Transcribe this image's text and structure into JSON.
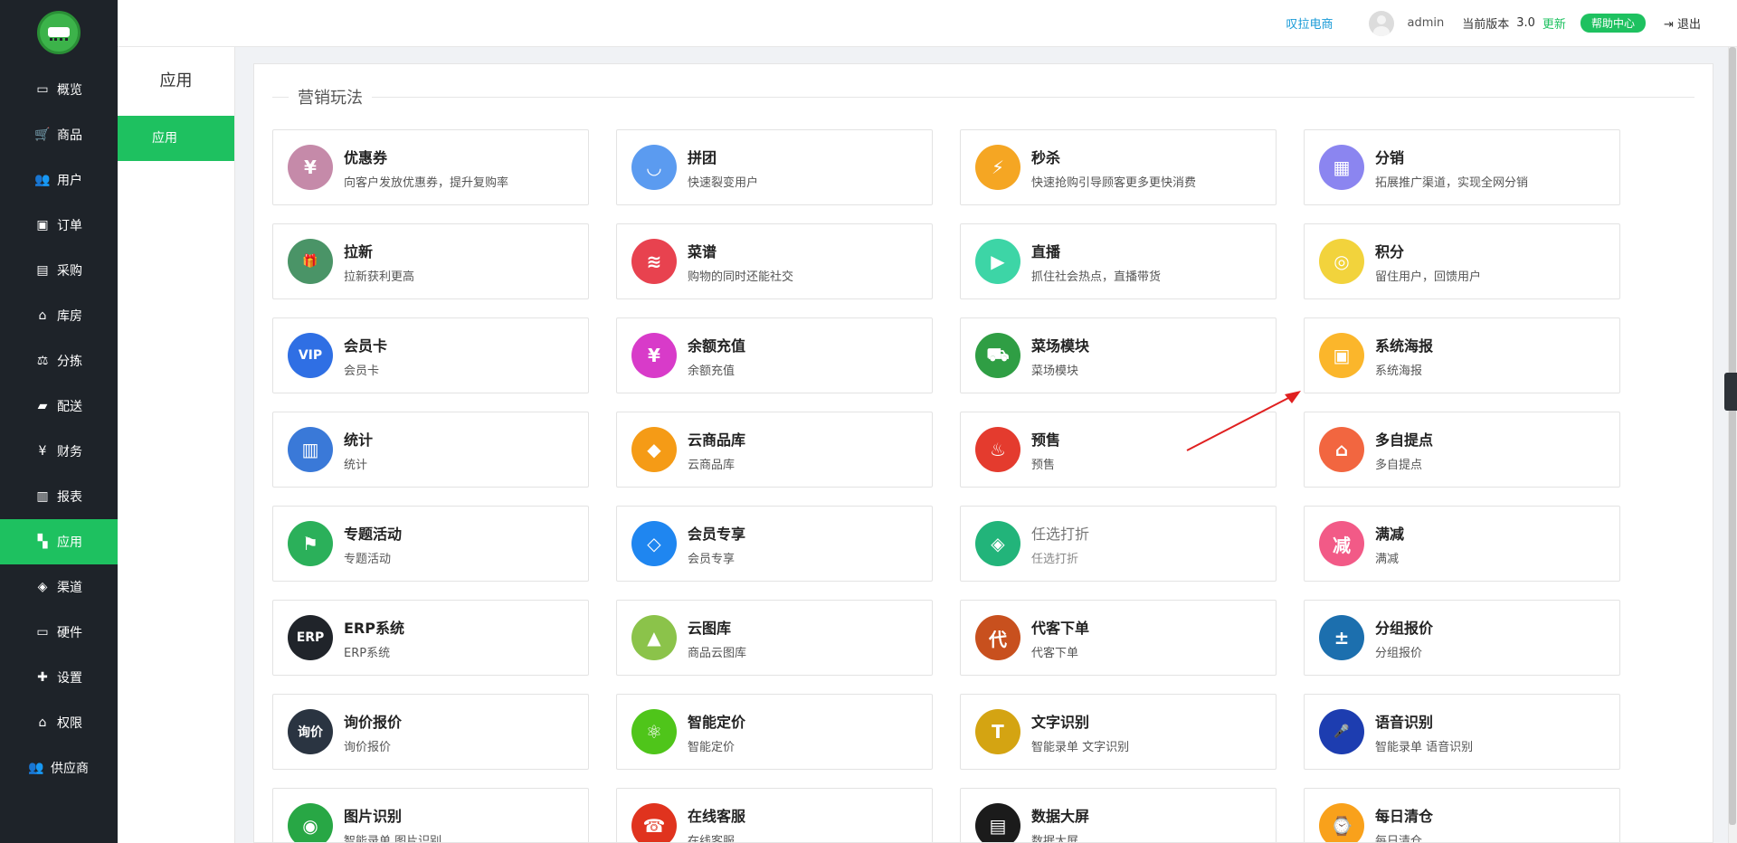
{
  "nav": {
    "items": [
      {
        "label": "概览",
        "icon": "monitor-icon",
        "glyph": "▭"
      },
      {
        "label": "商品",
        "icon": "cart-icon",
        "glyph": "🛒"
      },
      {
        "label": "用户",
        "icon": "users-icon",
        "glyph": "👥"
      },
      {
        "label": "订单",
        "icon": "money-icon",
        "glyph": "▣"
      },
      {
        "label": "采购",
        "icon": "truck-icon",
        "glyph": "▤"
      },
      {
        "label": "库房",
        "icon": "home-icon",
        "glyph": "⌂"
      },
      {
        "label": "分拣",
        "icon": "scale-icon",
        "glyph": "⚖"
      },
      {
        "label": "配送",
        "icon": "delivery-icon",
        "glyph": "▰"
      },
      {
        "label": "财务",
        "icon": "yen-icon",
        "glyph": "¥"
      },
      {
        "label": "报表",
        "icon": "bar-chart-icon",
        "glyph": "▥"
      },
      {
        "label": "应用",
        "icon": "apps-icon",
        "glyph": "▚",
        "active": true
      },
      {
        "label": "渠道",
        "icon": "cube-icon",
        "glyph": "◈"
      },
      {
        "label": "硬件",
        "icon": "desktop-icon",
        "glyph": "▭"
      },
      {
        "label": "设置",
        "icon": "puzzle-icon",
        "glyph": "✚"
      },
      {
        "label": "权限",
        "icon": "bank-icon",
        "glyph": "⌂"
      },
      {
        "label": "供应商",
        "icon": "supplier-icon",
        "glyph": "👥"
      }
    ]
  },
  "subnav": {
    "title": "应用",
    "item": "应用"
  },
  "header": {
    "brand": "叹拉电商",
    "user": "admin",
    "version_label": "当前版本",
    "version": "3.0",
    "update": "更新",
    "help": "帮助中心",
    "logout": "退出"
  },
  "section": {
    "title": "营销玩法"
  },
  "apps": [
    {
      "name": "优惠券",
      "desc": "向客户发放优惠券，提升复购率",
      "color": "#c58aa9",
      "glyph": "¥"
    },
    {
      "name": "拼团",
      "desc": "快速裂变用户",
      "color": "#5b9bf0",
      "glyph": "◡"
    },
    {
      "name": "秒杀",
      "desc": "快速抢购引导顾客更多更快消费",
      "color": "#f5a623",
      "glyph": "⚡"
    },
    {
      "name": "分销",
      "desc": "拓展推广渠道，实现全网分销",
      "color": "#8b85f0",
      "glyph": "▦"
    },
    {
      "name": "拉新",
      "desc": "拉新获利更高",
      "color": "#4a9467",
      "glyph": "🎁"
    },
    {
      "name": "菜谱",
      "desc": "购物的同时还能社交",
      "color": "#e8424f",
      "glyph": "≋"
    },
    {
      "name": "直播",
      "desc": "抓住社会热点，直播带货",
      "color": "#3dd5a6",
      "glyph": "▶"
    },
    {
      "name": "积分",
      "desc": "留住用户，回馈用户",
      "color": "#f2d33c",
      "glyph": "◎"
    },
    {
      "name": "会员卡",
      "desc": "会员卡",
      "color": "#2f6fe4",
      "glyph": "VIP"
    },
    {
      "name": "余额充值",
      "desc": "余额充值",
      "color": "#d83bc9",
      "glyph": "¥"
    },
    {
      "name": "菜场模块",
      "desc": "菜场模块",
      "color": "#2f9e44",
      "glyph": "⛟"
    },
    {
      "name": "系统海报",
      "desc": "系统海报",
      "color": "#fbb62b",
      "glyph": "▣"
    },
    {
      "name": "统计",
      "desc": "统计",
      "color": "#3a79d8",
      "glyph": "▥"
    },
    {
      "name": "云商品库",
      "desc": "云商品库",
      "color": "#f59b16",
      "glyph": "◆"
    },
    {
      "name": "预售",
      "desc": "预售",
      "color": "#e43b2e",
      "glyph": "♨"
    },
    {
      "name": "多自提点",
      "desc": "多自提点",
      "color": "#f26640",
      "glyph": "⌂"
    },
    {
      "name": "专题活动",
      "desc": "专题活动",
      "color": "#2bb05a",
      "glyph": "⚑"
    },
    {
      "name": "会员专享",
      "desc": "会员专享",
      "color": "#1f86f0",
      "glyph": "◇"
    },
    {
      "name": "任选打折",
      "desc": "任选打折",
      "color": "#22b47a",
      "glyph": "◈",
      "muted": true
    },
    {
      "name": "满减",
      "desc": "满减",
      "color": "#f25a87",
      "glyph": "减"
    },
    {
      "name": "ERP系统",
      "desc": "ERP系统",
      "color": "#20242a",
      "glyph": "ERP"
    },
    {
      "name": "云图库",
      "desc": "商品云图库",
      "color": "#8bc34a",
      "glyph": "▲"
    },
    {
      "name": "代客下单",
      "desc": "代客下单",
      "color": "#c8501e",
      "glyph": "代"
    },
    {
      "name": "分组报价",
      "desc": "分组报价",
      "color": "#1c6fae",
      "glyph": "±"
    },
    {
      "name": "询价报价",
      "desc": "询价报价",
      "color": "#2a3441",
      "glyph": "询价"
    },
    {
      "name": "智能定价",
      "desc": "智能定价",
      "color": "#4fc51a",
      "glyph": "⚛"
    },
    {
      "name": "文字识别",
      "desc": "智能录单 文字识别",
      "color": "#d4a412",
      "glyph": "T"
    },
    {
      "name": "语音识别",
      "desc": "智能录单 语音识别",
      "color": "#1d3db0",
      "glyph": "🎤"
    },
    {
      "name": "图片识别",
      "desc": "智能录单 图片识别",
      "color": "#28a745",
      "glyph": "◉"
    },
    {
      "name": "在线客服",
      "desc": "在线客服",
      "color": "#e0331e",
      "glyph": "☎"
    },
    {
      "name": "数据大屏",
      "desc": "数据大屏",
      "color": "#1b1b1b",
      "glyph": "▤"
    },
    {
      "name": "每日清仓",
      "desc": "每日清仓",
      "color": "#f9a11b",
      "glyph": "⌚"
    }
  ],
  "annotation": {
    "arrow_color": "#e02020"
  }
}
